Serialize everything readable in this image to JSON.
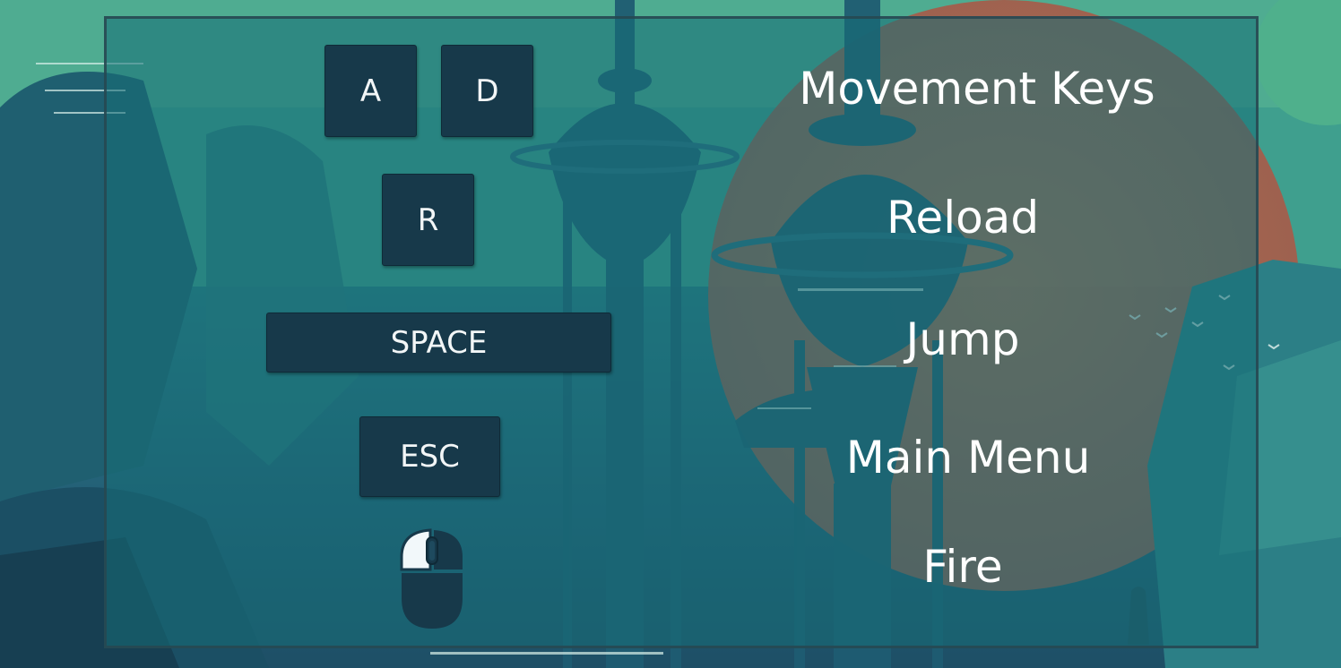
{
  "controls": [
    {
      "id": "move",
      "keys": [
        "A",
        "D"
      ],
      "action": "Movement Keys"
    },
    {
      "id": "reload",
      "keys": [
        "R"
      ],
      "action": "Reload"
    },
    {
      "id": "jump",
      "keys": [
        "SPACE"
      ],
      "action": "Jump"
    },
    {
      "id": "menu",
      "keys": [
        "ESC"
      ],
      "action": "Main Menu"
    },
    {
      "id": "fire",
      "keys": [
        "mouse-left-click-icon"
      ],
      "action": "Fire"
    }
  ],
  "colors": {
    "key_background": "#17394a",
    "key_text": "#f2f6f7",
    "action_text": "#ffffff",
    "panel_tint": "#166e76",
    "mouse_highlight": "#f2f8fa"
  }
}
